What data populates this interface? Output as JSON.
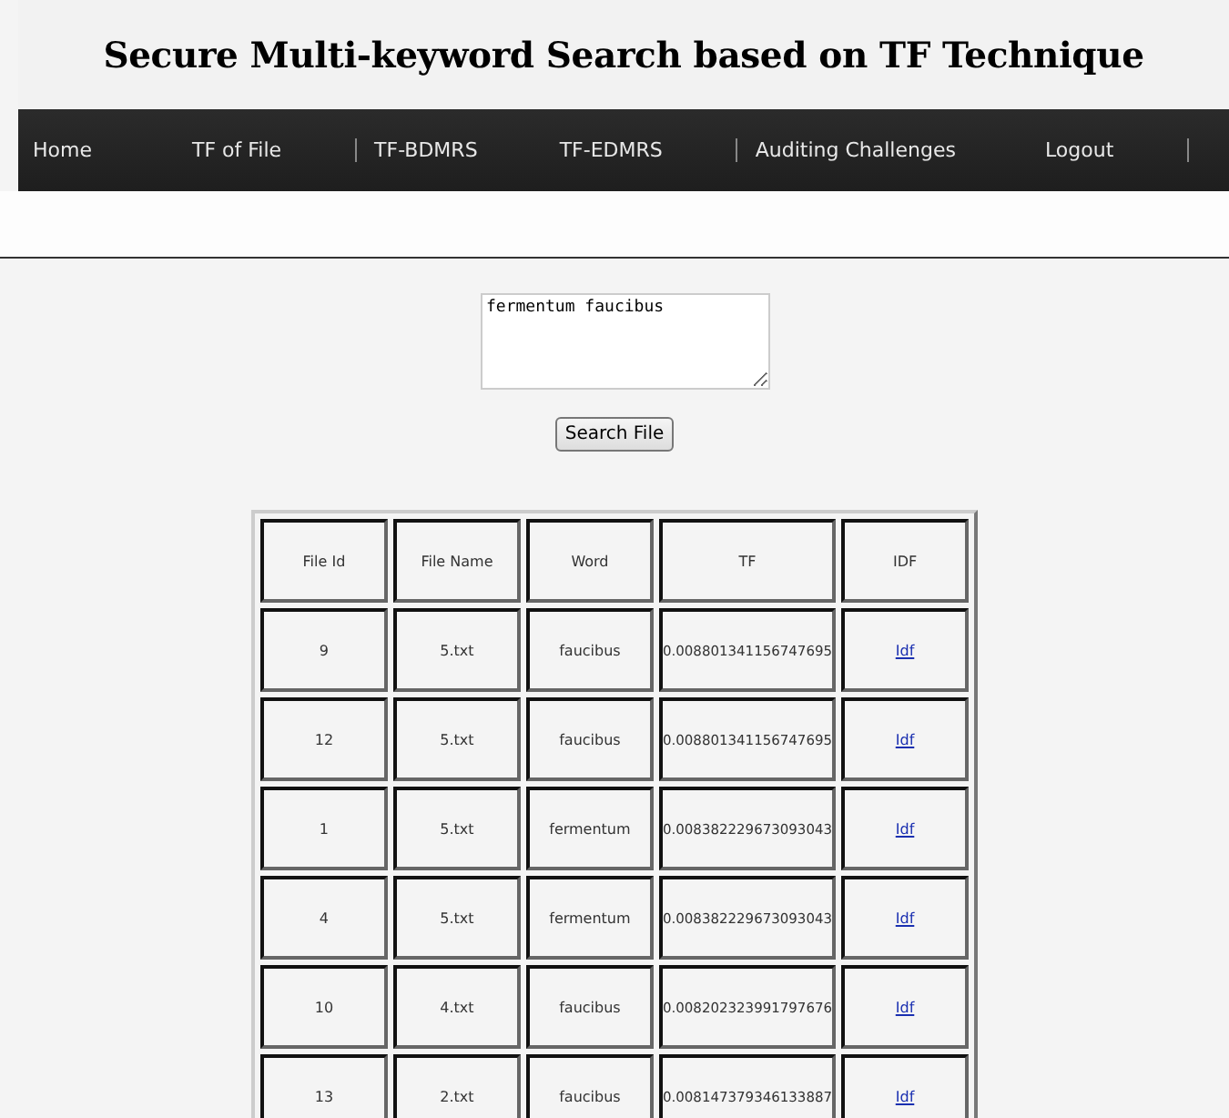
{
  "header": {
    "title": "Secure Multi-keyword Search based on TF Technique"
  },
  "nav": [
    {
      "label": "Home",
      "divider": false
    },
    {
      "label": "TF of File",
      "divider": true
    },
    {
      "label": "TF-BDMRS",
      "divider": false
    },
    {
      "label": "TF-EDMRS",
      "divider": true
    },
    {
      "label": "Auditing Challenges",
      "divider": false
    },
    {
      "label": "Logout",
      "divider": true
    }
  ],
  "search": {
    "value": "fermentum faucibus",
    "button": "Search File"
  },
  "table": {
    "columns": [
      "File Id",
      "File Name",
      "Word",
      "TF",
      "IDF"
    ],
    "rows": [
      {
        "file_id": "9",
        "file_name": "5.txt",
        "word": "faucibus",
        "tf": "0.008801341156747695",
        "idf": "Idf"
      },
      {
        "file_id": "12",
        "file_name": "5.txt",
        "word": "faucibus",
        "tf": "0.008801341156747695",
        "idf": "Idf"
      },
      {
        "file_id": "1",
        "file_name": "5.txt",
        "word": "fermentum",
        "tf": "0.008382229673093043",
        "idf": "Idf"
      },
      {
        "file_id": "4",
        "file_name": "5.txt",
        "word": "fermentum",
        "tf": "0.008382229673093043",
        "idf": "Idf"
      },
      {
        "file_id": "10",
        "file_name": "4.txt",
        "word": "faucibus",
        "tf": "0.008202323991797676",
        "idf": "Idf"
      },
      {
        "file_id": "13",
        "file_name": "2.txt",
        "word": "faucibus",
        "tf": "0.008147379346133887",
        "idf": "Idf"
      }
    ]
  }
}
